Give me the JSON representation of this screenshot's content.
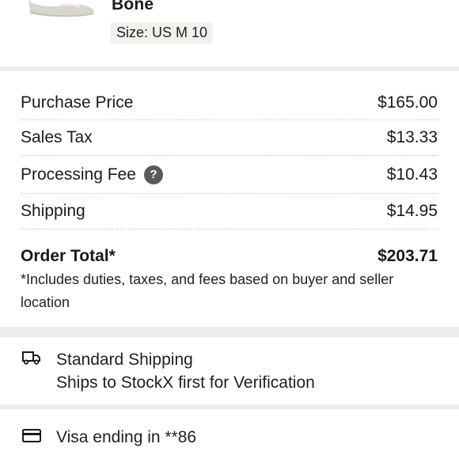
{
  "product": {
    "name": "Bone",
    "size": "Size: US M 10"
  },
  "pricing": {
    "rows": [
      {
        "label": "Purchase Price",
        "value": "$165.00"
      },
      {
        "label": "Sales Tax",
        "value": "$13.33"
      },
      {
        "label": "Processing Fee",
        "value": "$10.43",
        "help_icon": "?"
      },
      {
        "label": "Shipping",
        "value": "$14.95"
      }
    ],
    "total_label": "Order Total*",
    "total_value": "$203.71",
    "total_note": "*Includes duties, taxes, and fees based on buyer and seller location"
  },
  "shipping": {
    "icon": "truck-icon",
    "title": "Standard Shipping",
    "subtitle": "Ships to StockX first for Verification"
  },
  "payment": {
    "icon": "credit-card-icon",
    "label": "Visa ending in **86"
  }
}
